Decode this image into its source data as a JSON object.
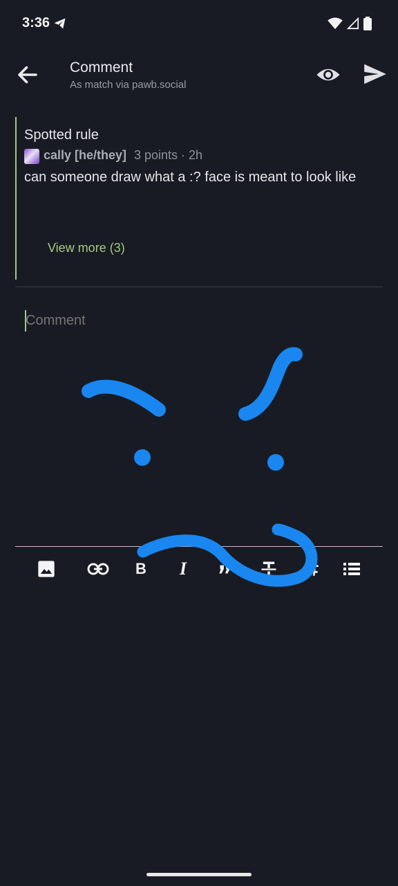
{
  "status_bar": {
    "time": "3:36",
    "icons": [
      "telegram-icon",
      "wifi-icon",
      "signal-icon",
      "battery-icon"
    ]
  },
  "app_bar": {
    "title": "Comment",
    "subtitle": "As match via pawb.social",
    "actions": [
      "back-arrow-icon",
      "eye-icon",
      "send-icon"
    ]
  },
  "quoted_post": {
    "title": "Spotted rule",
    "author": "cally [he/they]",
    "meta": "3 points · 2h",
    "body": "can someone draw what a :? face is meant to look like",
    "view_more": "View more (3)"
  },
  "comment_field": {
    "placeholder": "Comment"
  },
  "toolbar": {
    "items": [
      "image-icon",
      "link-icon",
      "bold-icon",
      "italic-icon",
      "quote-icon",
      "strikethrough-icon",
      "header-icon",
      "list-icon"
    ],
    "bold_label": "B",
    "italic_label": "I"
  },
  "colors": {
    "background": "#181b23",
    "accent": "#a5c982",
    "doodle": "#1a86f0"
  }
}
